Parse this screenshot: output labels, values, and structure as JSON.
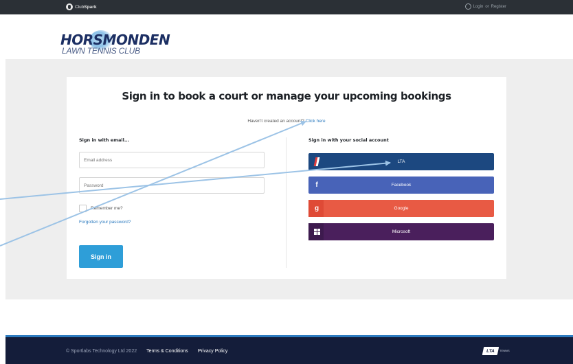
{
  "topbar": {
    "brand_prefix": "Club",
    "brand_name": "Spark",
    "login_label": "Login",
    "or_label": "or",
    "register_label": "Register"
  },
  "club": {
    "name": "HORSMONDEN",
    "subtitle": "LAWN TENNIS CLUB"
  },
  "signin": {
    "title": "Sign in to book a court or manage your upcoming bookings",
    "no_account_text": "Haven't created an account?",
    "click_here_link": "Click here",
    "email_heading": "Sign in with email...",
    "email_placeholder": "Email address",
    "password_placeholder": "Password",
    "remember_label": "Remember me?",
    "forgot_link": "Forgotten your password?",
    "signin_button": "Sign in",
    "social_heading": "Sign in with your social account",
    "social_buttons": [
      {
        "label": "LTA",
        "icon": "lta-icon",
        "color": "#1c4880"
      },
      {
        "label": "Facebook",
        "icon": "facebook-icon",
        "color": "#4863b8"
      },
      {
        "label": "Google",
        "icon": "google-icon",
        "color": "#e85a44"
      },
      {
        "label": "Microsoft",
        "icon": "microsoft-icon",
        "color": "#4a1f5c"
      }
    ]
  },
  "footer": {
    "copyright": "© Sportlabs Technology Ltd 2022",
    "terms_link": "Terms & Conditions",
    "privacy_link": "Privacy Policy",
    "lta_logo_text": "LTA",
    "lta_logo_subtext": "TENNIS"
  },
  "colors": {
    "accent": "#2e9ed8",
    "link": "#2d7bbf",
    "topbar": "#2b3036",
    "footer": "#141d3a",
    "annotation_arrow": "#9cc3e6"
  }
}
